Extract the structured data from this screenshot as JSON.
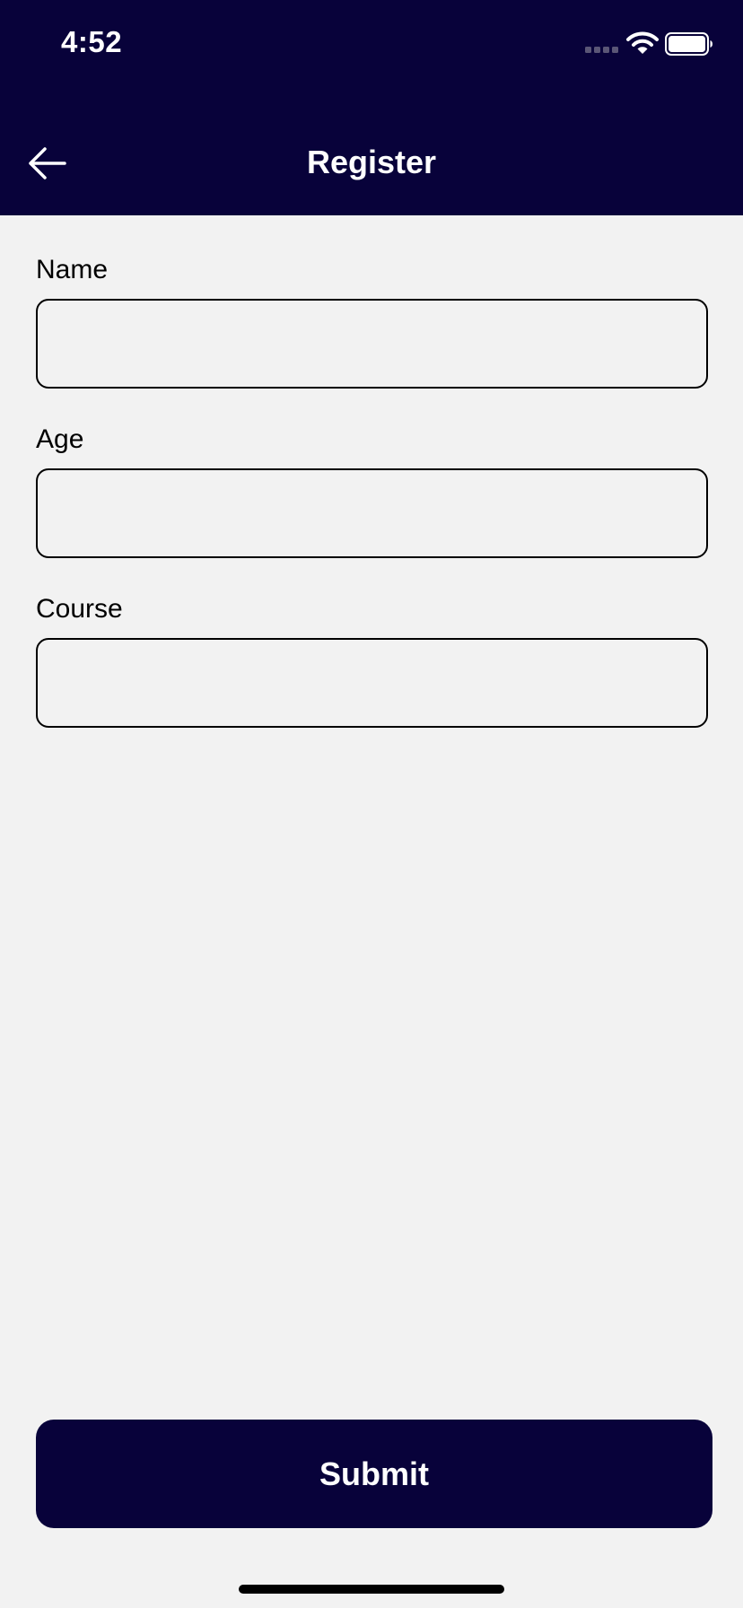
{
  "status_bar": {
    "time": "4:52"
  },
  "nav": {
    "title": "Register",
    "back_icon": "arrow-left-icon"
  },
  "form": {
    "fields": [
      {
        "label": "Name",
        "value": "",
        "placeholder": ""
      },
      {
        "label": "Age",
        "value": "",
        "placeholder": ""
      },
      {
        "label": "Course",
        "value": "",
        "placeholder": ""
      }
    ],
    "submit_label": "Submit"
  },
  "colors": {
    "primary": "#08023a",
    "background": "#f2f2f2",
    "text": "#000000",
    "on_primary": "#ffffff"
  },
  "icons": {
    "cellular": "cellular-signal-icon",
    "wifi": "wifi-icon",
    "battery": "battery-icon"
  }
}
